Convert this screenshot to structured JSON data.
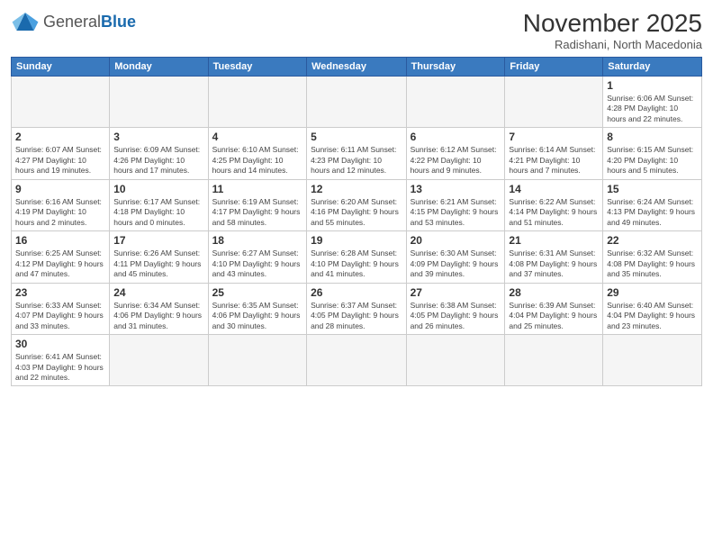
{
  "logo": {
    "general": "General",
    "blue": "Blue"
  },
  "title": "November 2025",
  "subtitle": "Radishani, North Macedonia",
  "days_of_week": [
    "Sunday",
    "Monday",
    "Tuesday",
    "Wednesday",
    "Thursday",
    "Friday",
    "Saturday"
  ],
  "weeks": [
    [
      {
        "day": "",
        "info": ""
      },
      {
        "day": "",
        "info": ""
      },
      {
        "day": "",
        "info": ""
      },
      {
        "day": "",
        "info": ""
      },
      {
        "day": "",
        "info": ""
      },
      {
        "day": "",
        "info": ""
      },
      {
        "day": "1",
        "info": "Sunrise: 6:06 AM\nSunset: 4:28 PM\nDaylight: 10 hours\nand 22 minutes."
      }
    ],
    [
      {
        "day": "2",
        "info": "Sunrise: 6:07 AM\nSunset: 4:27 PM\nDaylight: 10 hours\nand 19 minutes."
      },
      {
        "day": "3",
        "info": "Sunrise: 6:09 AM\nSunset: 4:26 PM\nDaylight: 10 hours\nand 17 minutes."
      },
      {
        "day": "4",
        "info": "Sunrise: 6:10 AM\nSunset: 4:25 PM\nDaylight: 10 hours\nand 14 minutes."
      },
      {
        "day": "5",
        "info": "Sunrise: 6:11 AM\nSunset: 4:23 PM\nDaylight: 10 hours\nand 12 minutes."
      },
      {
        "day": "6",
        "info": "Sunrise: 6:12 AM\nSunset: 4:22 PM\nDaylight: 10 hours\nand 9 minutes."
      },
      {
        "day": "7",
        "info": "Sunrise: 6:14 AM\nSunset: 4:21 PM\nDaylight: 10 hours\nand 7 minutes."
      },
      {
        "day": "8",
        "info": "Sunrise: 6:15 AM\nSunset: 4:20 PM\nDaylight: 10 hours\nand 5 minutes."
      }
    ],
    [
      {
        "day": "9",
        "info": "Sunrise: 6:16 AM\nSunset: 4:19 PM\nDaylight: 10 hours\nand 2 minutes."
      },
      {
        "day": "10",
        "info": "Sunrise: 6:17 AM\nSunset: 4:18 PM\nDaylight: 10 hours\nand 0 minutes."
      },
      {
        "day": "11",
        "info": "Sunrise: 6:19 AM\nSunset: 4:17 PM\nDaylight: 9 hours\nand 58 minutes."
      },
      {
        "day": "12",
        "info": "Sunrise: 6:20 AM\nSunset: 4:16 PM\nDaylight: 9 hours\nand 55 minutes."
      },
      {
        "day": "13",
        "info": "Sunrise: 6:21 AM\nSunset: 4:15 PM\nDaylight: 9 hours\nand 53 minutes."
      },
      {
        "day": "14",
        "info": "Sunrise: 6:22 AM\nSunset: 4:14 PM\nDaylight: 9 hours\nand 51 minutes."
      },
      {
        "day": "15",
        "info": "Sunrise: 6:24 AM\nSunset: 4:13 PM\nDaylight: 9 hours\nand 49 minutes."
      }
    ],
    [
      {
        "day": "16",
        "info": "Sunrise: 6:25 AM\nSunset: 4:12 PM\nDaylight: 9 hours\nand 47 minutes."
      },
      {
        "day": "17",
        "info": "Sunrise: 6:26 AM\nSunset: 4:11 PM\nDaylight: 9 hours\nand 45 minutes."
      },
      {
        "day": "18",
        "info": "Sunrise: 6:27 AM\nSunset: 4:10 PM\nDaylight: 9 hours\nand 43 minutes."
      },
      {
        "day": "19",
        "info": "Sunrise: 6:28 AM\nSunset: 4:10 PM\nDaylight: 9 hours\nand 41 minutes."
      },
      {
        "day": "20",
        "info": "Sunrise: 6:30 AM\nSunset: 4:09 PM\nDaylight: 9 hours\nand 39 minutes."
      },
      {
        "day": "21",
        "info": "Sunrise: 6:31 AM\nSunset: 4:08 PM\nDaylight: 9 hours\nand 37 minutes."
      },
      {
        "day": "22",
        "info": "Sunrise: 6:32 AM\nSunset: 4:08 PM\nDaylight: 9 hours\nand 35 minutes."
      }
    ],
    [
      {
        "day": "23",
        "info": "Sunrise: 6:33 AM\nSunset: 4:07 PM\nDaylight: 9 hours\nand 33 minutes."
      },
      {
        "day": "24",
        "info": "Sunrise: 6:34 AM\nSunset: 4:06 PM\nDaylight: 9 hours\nand 31 minutes."
      },
      {
        "day": "25",
        "info": "Sunrise: 6:35 AM\nSunset: 4:06 PM\nDaylight: 9 hours\nand 30 minutes."
      },
      {
        "day": "26",
        "info": "Sunrise: 6:37 AM\nSunset: 4:05 PM\nDaylight: 9 hours\nand 28 minutes."
      },
      {
        "day": "27",
        "info": "Sunrise: 6:38 AM\nSunset: 4:05 PM\nDaylight: 9 hours\nand 26 minutes."
      },
      {
        "day": "28",
        "info": "Sunrise: 6:39 AM\nSunset: 4:04 PM\nDaylight: 9 hours\nand 25 minutes."
      },
      {
        "day": "29",
        "info": "Sunrise: 6:40 AM\nSunset: 4:04 PM\nDaylight: 9 hours\nand 23 minutes."
      }
    ],
    [
      {
        "day": "30",
        "info": "Sunrise: 6:41 AM\nSunset: 4:03 PM\nDaylight: 9 hours\nand 22 minutes."
      },
      {
        "day": "",
        "info": ""
      },
      {
        "day": "",
        "info": ""
      },
      {
        "day": "",
        "info": ""
      },
      {
        "day": "",
        "info": ""
      },
      {
        "day": "",
        "info": ""
      },
      {
        "day": "",
        "info": ""
      }
    ]
  ],
  "accent_color": "#3a7abf"
}
